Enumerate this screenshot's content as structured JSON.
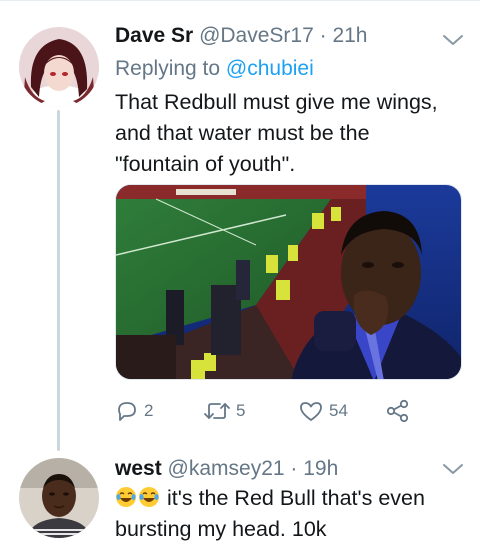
{
  "tweets": [
    {
      "name": "Dave Sr",
      "handle": "@DaveSr17",
      "dot": "·",
      "time": "21h",
      "replying_prefix": "Replying to ",
      "replying_to": "@chubiei",
      "text_lines": [
        "That Redbull must give me wings,",
        "and that water must be the",
        "\"fountain of youth\"."
      ],
      "actions": {
        "reply_count": "2",
        "retweet_count": "5",
        "like_count": "54"
      }
    },
    {
      "name": "west",
      "handle": "@kamsey21",
      "dot": "·",
      "time": "19h",
      "text_lines": [
        "it's the Red Bull that's even",
        "bursting my head. 10k"
      ]
    }
  ],
  "icons": {
    "reply": "reply-icon",
    "retweet": "retweet-icon",
    "like": "heart-icon",
    "share": "share-icon",
    "more": "chevron-down-icon",
    "emoji": "face-with-tears-of-joy"
  },
  "colors": {
    "text": "#14171a",
    "secondary": "#657786",
    "link": "#1da1f2",
    "thread_line": "#ccd6dd"
  }
}
